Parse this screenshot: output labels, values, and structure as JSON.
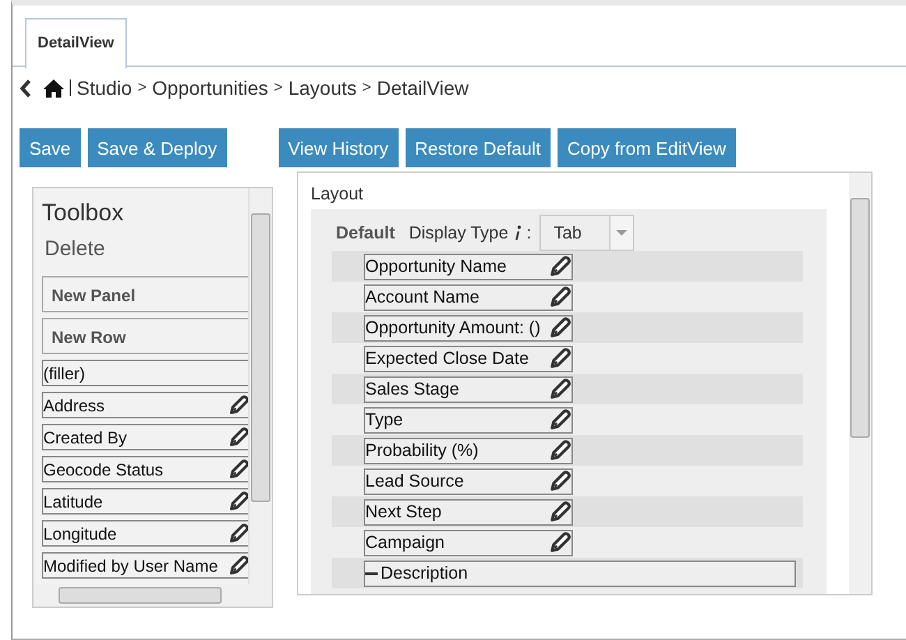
{
  "tabs": [
    {
      "label": "DetailView",
      "selected": true
    }
  ],
  "breadcrumb": {
    "items": [
      "Studio",
      "Opportunities",
      "Layouts",
      "DetailView"
    ],
    "separator": ">"
  },
  "buttons": {
    "left": [
      "Save",
      "Save & Deploy"
    ],
    "right": [
      "View History",
      "Restore Default",
      "Copy from EditView"
    ]
  },
  "toolbox": {
    "title": "Toolbox",
    "delete": "Delete",
    "items": [
      {
        "label": "New Panel",
        "kind": "panel"
      },
      {
        "label": "New Row",
        "kind": "panel"
      },
      {
        "label": "(filler)",
        "kind": "plain"
      },
      {
        "label": "Address",
        "kind": "field"
      },
      {
        "label": "Created By",
        "kind": "field"
      },
      {
        "label": "Geocode Status",
        "kind": "field"
      },
      {
        "label": "Latitude",
        "kind": "field"
      },
      {
        "label": "Longitude",
        "kind": "field"
      },
      {
        "label": "Modified by User Name",
        "kind": "field"
      }
    ]
  },
  "layout": {
    "title": "Layout",
    "panel_label": "Default",
    "display_type_label": "Display Type",
    "display_type_suffix": ":",
    "display_type_value": "Tab",
    "fields": [
      {
        "label": "Opportunity Name",
        "kind": "field"
      },
      {
        "label": "Account Name",
        "kind": "field"
      },
      {
        "label": "Opportunity Amount: ()",
        "kind": "field"
      },
      {
        "label": "Expected Close Date",
        "kind": "field"
      },
      {
        "label": "Sales Stage",
        "kind": "field"
      },
      {
        "label": "Type",
        "kind": "field"
      },
      {
        "label": "Probability (%)",
        "kind": "field"
      },
      {
        "label": "Lead Source",
        "kind": "field"
      },
      {
        "label": "Next Step",
        "kind": "field"
      },
      {
        "label": "Campaign",
        "kind": "field"
      },
      {
        "label": "Description",
        "kind": "wide"
      }
    ]
  }
}
